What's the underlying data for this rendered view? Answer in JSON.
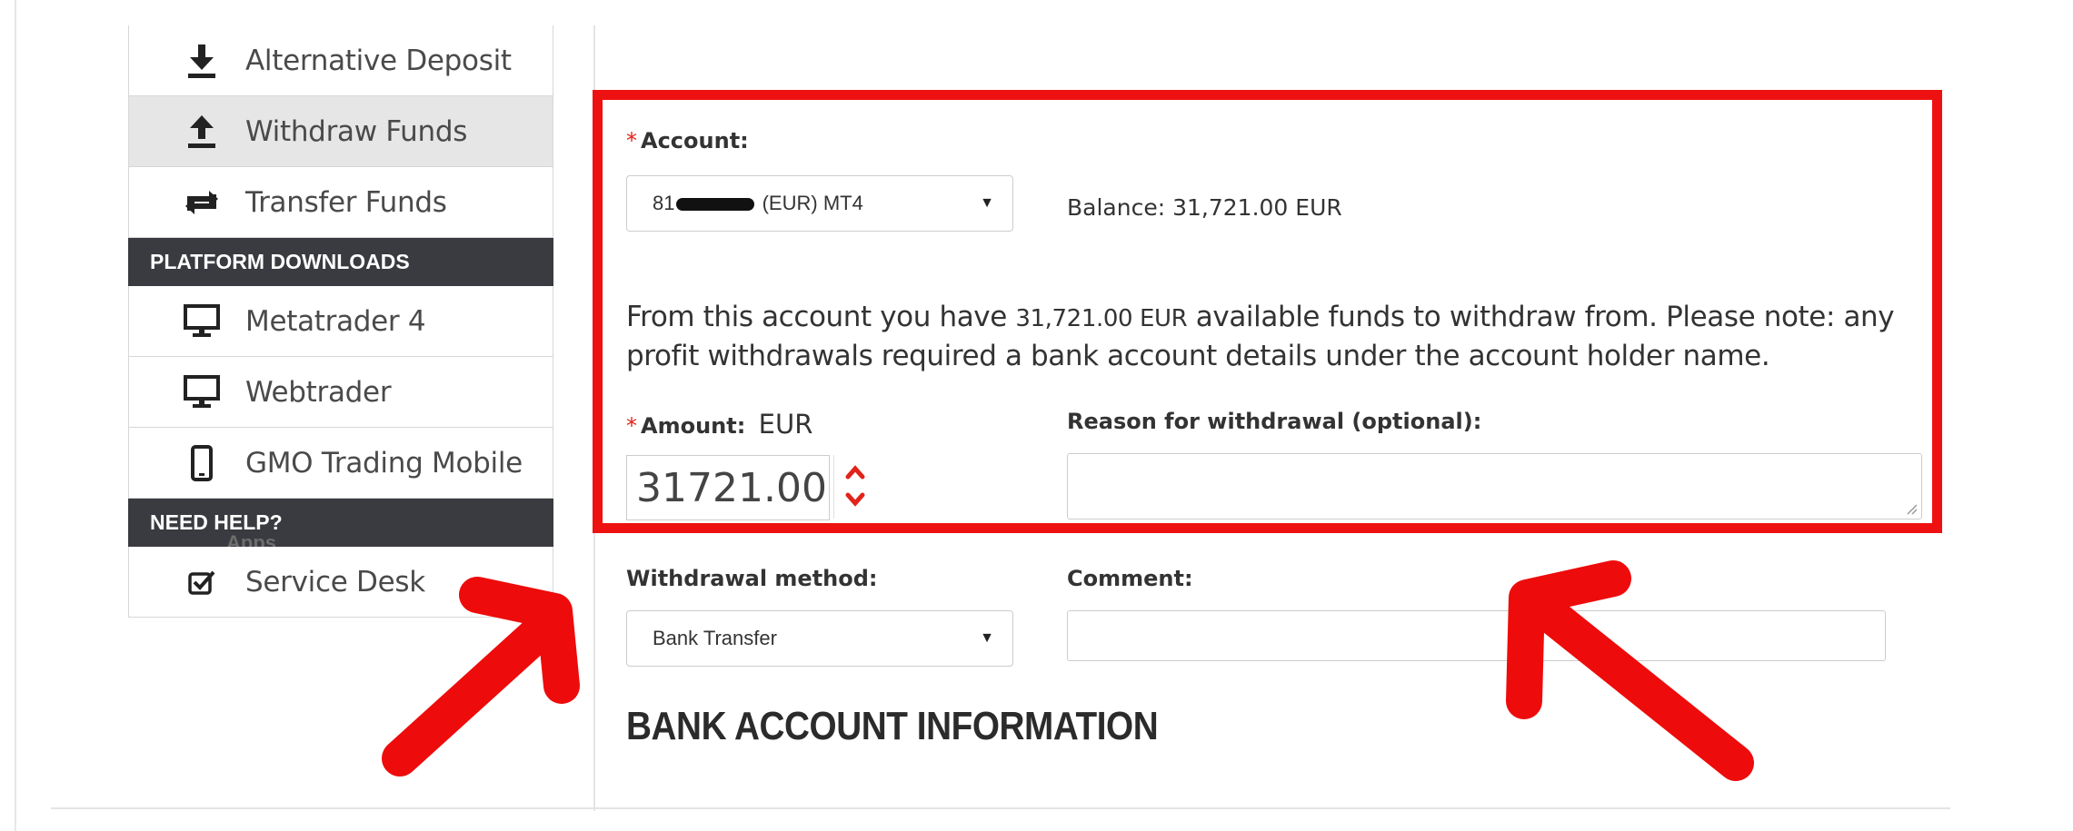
{
  "sidebar": {
    "items_top": [
      {
        "label": "Alternative Deposit",
        "icon": "download-icon"
      },
      {
        "label": "Withdraw Funds",
        "icon": "upload-icon",
        "active": true
      },
      {
        "label": "Transfer Funds",
        "icon": "transfer-icon"
      }
    ],
    "platform_header": "PLATFORM DOWNLOADS",
    "platform_items": [
      {
        "label": "Metatrader 4",
        "icon": "monitor-icon"
      },
      {
        "label": "Webtrader",
        "icon": "monitor-icon"
      },
      {
        "label": "GMO Trading Mobile",
        "icon": "mobile-icon"
      }
    ],
    "help_header": "NEED HELP?",
    "help_ghost_text": "Apps",
    "help_items": [
      {
        "label": "Service Desk",
        "icon": "checkbox-icon"
      }
    ]
  },
  "form": {
    "required_mark": "*",
    "account": {
      "label": "Account:",
      "value_prefix": "81",
      "value_suffix": "(EUR) MT4"
    },
    "balance": {
      "label": "Balance:",
      "value": "31,721.00 EUR"
    },
    "notice": {
      "before": "From this account you have",
      "amount": "31,721.00 EUR",
      "after": "available funds to withdraw from. Please note: any profit withdrawals required a bank account details under the account holder name."
    },
    "amount": {
      "label": "Amount:",
      "currency": "EUR",
      "value": "31721.00"
    },
    "reason": {
      "label": "Reason for withdrawal (optional):",
      "value": ""
    },
    "withdrawal_method": {
      "label": "Withdrawal method:",
      "value": "Bank Transfer"
    },
    "comment": {
      "label": "Comment:",
      "value": ""
    },
    "bank_section_title": "BANK ACCOUNT INFORMATION"
  },
  "annotations": {
    "highlight_color": "#ee1111",
    "arrow_color": "#ee0b0b"
  }
}
